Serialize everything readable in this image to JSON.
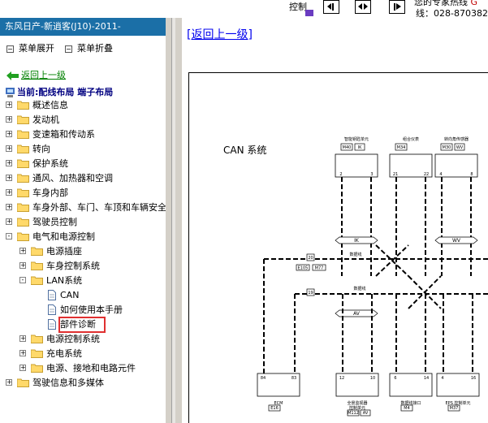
{
  "topbar": {
    "control_label": "控制",
    "contact_line1": "您的专家热线 ",
    "contact_line1_red": "G",
    "contact_line2": "线：028-870382"
  },
  "leftpane": {
    "title": "东风日产-新逍客(J10)-2011-",
    "expand_label": "菜单展开",
    "collapse_label": "菜单折叠",
    "back_label": "返回上一级",
    "current_label": "当前:配线布局 端子布局"
  },
  "tree": [
    {
      "label": "概述信息",
      "level": 0,
      "type": "folder",
      "sign": "+"
    },
    {
      "label": "发动机",
      "level": 0,
      "type": "folder",
      "sign": "+"
    },
    {
      "label": "变速箱和传动系",
      "level": 0,
      "type": "folder",
      "sign": "+"
    },
    {
      "label": "转向",
      "level": 0,
      "type": "folder",
      "sign": "+"
    },
    {
      "label": "保护系统",
      "level": 0,
      "type": "folder",
      "sign": "+"
    },
    {
      "label": "通风、加热器和空调",
      "level": 0,
      "type": "folder",
      "sign": "+"
    },
    {
      "label": "车身内部",
      "level": 0,
      "type": "folder",
      "sign": "+"
    },
    {
      "label": "车身外部、车门、车顶和车辆安全",
      "level": 0,
      "type": "folder",
      "sign": "+"
    },
    {
      "label": "驾驶员控制",
      "level": 0,
      "type": "folder",
      "sign": "+"
    },
    {
      "label": "电气和电源控制",
      "level": 0,
      "type": "folder",
      "sign": "-"
    },
    {
      "label": "电源插座",
      "level": 1,
      "type": "folder",
      "sign": "+"
    },
    {
      "label": "车身控制系统",
      "level": 1,
      "type": "folder",
      "sign": "+"
    },
    {
      "label": "LAN系统",
      "level": 1,
      "type": "folder",
      "sign": "-"
    },
    {
      "label": "CAN",
      "level": 2,
      "type": "doc"
    },
    {
      "label": "如何使用本手册",
      "level": 2,
      "type": "doc"
    },
    {
      "label": "部件诊断",
      "level": 2,
      "type": "doc",
      "highlight": true
    },
    {
      "label": "电源控制系统",
      "level": 1,
      "type": "folder",
      "sign": "+"
    },
    {
      "label": "充电系统",
      "level": 1,
      "type": "folder",
      "sign": "+"
    },
    {
      "label": "电源、接地和电路元件",
      "level": 1,
      "type": "folder",
      "sign": "+"
    },
    {
      "label": "驾驶信息和多媒体",
      "level": 0,
      "type": "folder",
      "sign": "+"
    }
  ],
  "content": {
    "back_link": "[返回上一级]",
    "diagram_title": "CAN 系统"
  },
  "diagram": {
    "top_units": [
      {
        "name": "智能钥匙单元",
        "code": "M40",
        "pin_code": "IK",
        "pins": [
          "2",
          "3"
        ]
      },
      {
        "name": "组合仪表",
        "code": "M34",
        "pins": [
          "21",
          "22"
        ]
      },
      {
        "name": "转向角传感器",
        "code": "M30",
        "pin_code": "WV",
        "pins": [
          "4",
          "8"
        ]
      }
    ],
    "bottom_units": [
      {
        "name": "ECM",
        "code": "E16",
        "pins": [
          "84",
          "83"
        ]
      },
      {
        "name": "全景监视器\n控制单元",
        "code": "M112",
        "pin_code": "AV",
        "pins": [
          "12",
          "10"
        ]
      },
      {
        "name": "数据线接口",
        "code": "M4",
        "pins": [
          "6",
          "14"
        ]
      },
      {
        "name": "EPS 控制单元",
        "code": "M37",
        "pins": [
          "4",
          "16"
        ]
      }
    ],
    "bus_labels": [
      "IK",
      "WV",
      "AV"
    ],
    "data_line_label": "数据线",
    "junctions": [
      "20",
      "19"
    ],
    "connectors": [
      "E105",
      "M77"
    ]
  },
  "colors": {
    "titlebar": "#1b6fa7",
    "back_green": "#008000",
    "current_navy": "#000080",
    "link_blue": "#0000ee",
    "highlight_red": "#e03030"
  }
}
